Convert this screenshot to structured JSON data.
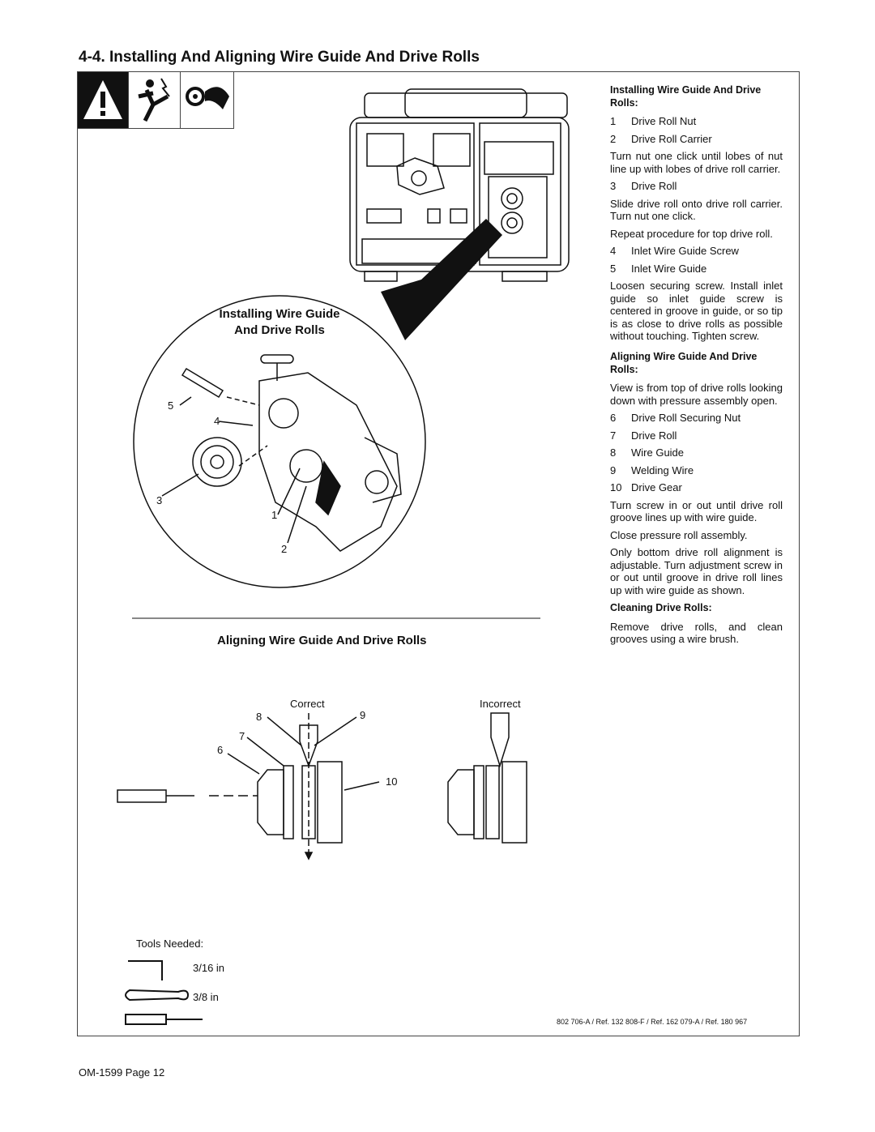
{
  "title": "4-4.  Installing And Aligning Wire Guide And Drive Rolls",
  "install_heading_line1": "Installing Wire Guide",
  "install_heading_line2": "And Drive Rolls",
  "align_heading": "Aligning Wire Guide And Drive Rolls",
  "callouts": {
    "c1": "1",
    "c2": "2",
    "c3": "3",
    "c4": "4",
    "c5": "5",
    "c6": "6",
    "c7": "7",
    "c8": "8",
    "c9": "9",
    "c10": "10"
  },
  "correct": "Correct",
  "incorrect": "Incorrect",
  "tools": {
    "label": "Tools Needed:",
    "hex": "3/16 in",
    "wrench": "3/8 in"
  },
  "ref": "802 706-A / Ref. 132 808-F / Ref. 162 079-A / Ref. 180 967",
  "footer": "OM-1599 Page 12",
  "right": {
    "h1": "Installing Wire Guide And Drive Rolls:",
    "items1": [
      {
        "n": "1",
        "t": "Drive Roll Nut"
      },
      {
        "n": "2",
        "t": "Drive Roll Carrier"
      }
    ],
    "p1": "Turn nut one click until lobes of nut line up with lobes of drive roll carrier.",
    "items2": [
      {
        "n": "3",
        "t": "Drive Roll"
      }
    ],
    "p2": "Slide drive roll onto drive roll carrier. Turn nut one click.",
    "p3": "Repeat procedure for top drive roll.",
    "items3": [
      {
        "n": "4",
        "t": "Inlet Wire Guide Screw"
      },
      {
        "n": "5",
        "t": "Inlet Wire Guide"
      }
    ],
    "p4": "Loosen securing screw. Install inlet guide so inlet guide screw is centered in groove in guide, or so tip is as close to drive rolls as possible without touching. Tighten screw.",
    "h2": "Aligning Wire Guide And Drive Rolls:",
    "p5": "View is from top of drive rolls looking down with pressure assembly open.",
    "items4": [
      {
        "n": "6",
        "t": "Drive Roll Securing Nut"
      },
      {
        "n": "7",
        "t": "Drive Roll"
      },
      {
        "n": "8",
        "t": "Wire Guide"
      },
      {
        "n": "9",
        "t": "Welding Wire"
      },
      {
        "n": "10",
        "t": "Drive Gear"
      }
    ],
    "p6": "Turn screw in or out until drive roll groove lines up with wire guide.",
    "p7": "Close pressure roll assembly.",
    "p8": "Only bottom drive roll alignment is adjustable. Turn adjustment screw in or out until groove in drive roll lines up with wire guide as shown.",
    "h3": "Cleaning Drive Rolls:",
    "p9": "Remove drive rolls, and clean grooves using a wire brush."
  }
}
